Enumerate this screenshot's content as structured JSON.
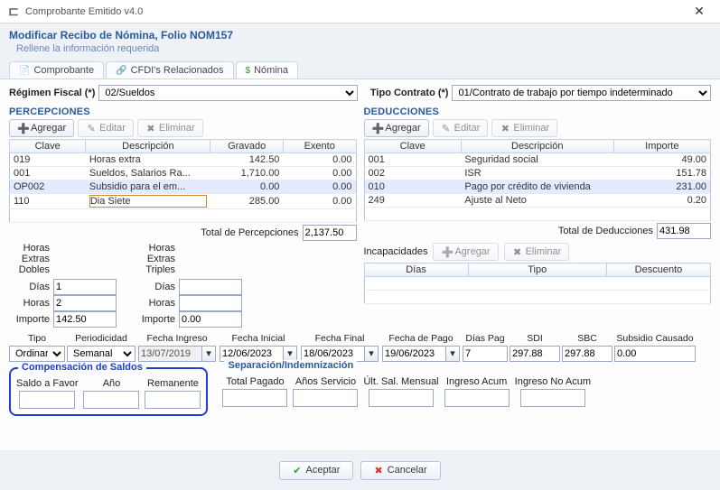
{
  "window": {
    "title": "Comprobante Emitido v4.0"
  },
  "header": {
    "title": "Modificar Recibo de Nómina, Folio NOM157",
    "subtitle": "Rellene la información requerida"
  },
  "tabs": {
    "comprobante": "Comprobante",
    "cfdis": "CFDI's Relacionados",
    "nomina": "Nómina"
  },
  "top": {
    "regimen_lbl": "Régimen Fiscal (*)",
    "regimen_val": "02/Sueldos",
    "tipo_contrato_lbl": "Tipo Contrato (*)",
    "tipo_contrato_val": "01/Contrato de trabajo por tiempo indeterminado"
  },
  "percepciones": {
    "title": "PERCEPCIONES",
    "agregar": "Agregar",
    "editar": "Editar",
    "eliminar": "Eliminar",
    "cols": {
      "clave": "Clave",
      "desc": "Descripción",
      "gravado": "Gravado",
      "exento": "Exento"
    },
    "rows": [
      {
        "clave": "019",
        "desc": "Horas extra",
        "gravado": "142.50",
        "exento": "0.00"
      },
      {
        "clave": "001",
        "desc": "Sueldos, Salarios  Ra...",
        "gravado": "1,710.00",
        "exento": "0.00"
      },
      {
        "clave": "OP002",
        "desc": "Subsidio para el em...",
        "gravado": "0.00",
        "exento": "0.00"
      },
      {
        "clave": "110",
        "desc": "Dia Siete",
        "gravado": "285.00",
        "exento": "0.00",
        "editing": true
      }
    ],
    "total_lbl": "Total de Percepciones",
    "total_val": "2,137.50"
  },
  "deducciones": {
    "title": "DEDUCCIONES",
    "agregar": "Agregar",
    "editar": "Editar",
    "eliminar": "Eliminar",
    "cols": {
      "clave": "Clave",
      "desc": "Descripción",
      "importe": "Importe"
    },
    "rows": [
      {
        "clave": "001",
        "desc": "Seguridad social",
        "importe": "49.00"
      },
      {
        "clave": "002",
        "desc": "ISR",
        "importe": "151.78"
      },
      {
        "clave": "010",
        "desc": "Pago por crédito de vivienda",
        "importe": "231.00",
        "sel": true
      },
      {
        "clave": "249",
        "desc": "Ajuste al Neto",
        "importe": "0.20"
      }
    ],
    "total_lbl": "Total de Deducciones",
    "total_val": "431.98"
  },
  "horas": {
    "dobles": "Horas Extras Dobles",
    "triples": "Horas Extras Triples",
    "dias_lbl": "Días",
    "horas_lbl": "Horas",
    "importe_lbl": "Importe",
    "d_dias": "1",
    "d_horas": "2",
    "d_importe": "142.50",
    "t_dias": "",
    "t_horas": "",
    "t_importe": "0.00"
  },
  "incap": {
    "title": "Incapacidades",
    "agregar": "Agregar",
    "eliminar": "Eliminar",
    "cols": {
      "dias": "Días",
      "tipo": "Tipo",
      "descuento": "Descuento"
    }
  },
  "fechas": {
    "tipo": "Tipo",
    "tipo_val": "Ordinaria",
    "period": "Periodicidad",
    "period_val": "Semanal",
    "fing": "Fecha Ingreso",
    "fing_val": "13/07/2019",
    "fini": "Fecha Inicial",
    "fini_val": "12/06/2023",
    "ffin": "Fecha Final",
    "ffin_val": "18/06/2023",
    "fpago": "Fecha de Pago",
    "fpago_val": "19/06/2023",
    "diasp": "Días Pag",
    "diasp_val": "7",
    "sdi": "SDI",
    "sdi_val": "297.88",
    "sbc": "SBC",
    "sbc_val": "297.88",
    "sub": "Subsidio Causado",
    "sub_val": "0.00"
  },
  "comp": {
    "title": "Compensación de Saldos",
    "saldo": "Saldo a Favor",
    "ano": "Año",
    "rem": "Remanente"
  },
  "sep": {
    "title": "Separación/Indemnización",
    "tp": "Total Pagado",
    "as": "Años Servicio",
    "usm": "Últ. Sal. Mensual",
    "ia": "Ingreso Acum",
    "ina": "Ingreso No Acum"
  },
  "footer": {
    "ok": "Aceptar",
    "cancel": "Cancelar"
  }
}
